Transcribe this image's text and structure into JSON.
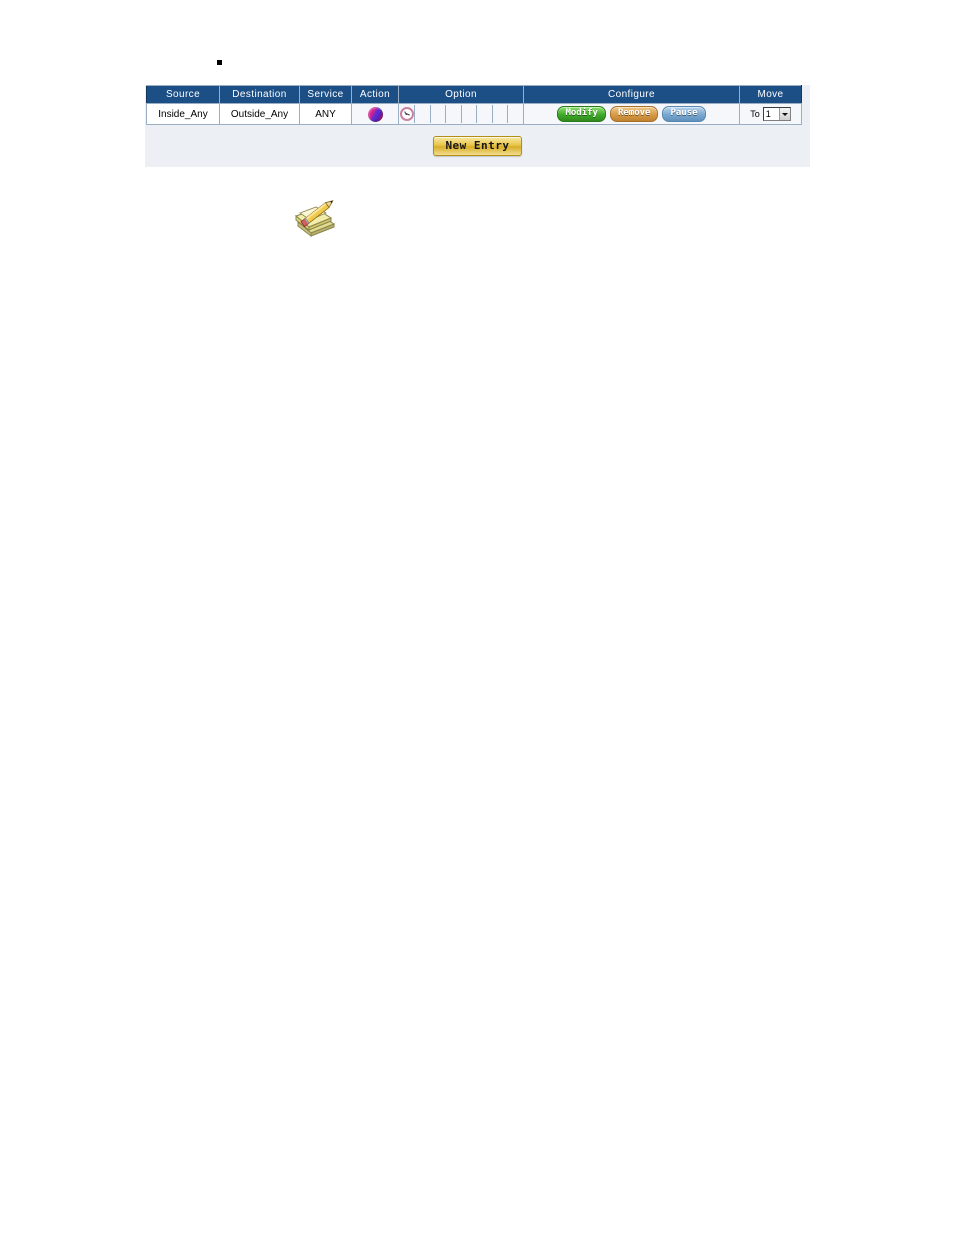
{
  "page": {
    "bullet_marker": "square-bullet"
  },
  "policy_table": {
    "headers": [
      {
        "key": "source",
        "label": "Source"
      },
      {
        "key": "destination",
        "label": "Destination"
      },
      {
        "key": "service",
        "label": "Service"
      },
      {
        "key": "action",
        "label": "Action"
      },
      {
        "key": "option",
        "label": "Option"
      },
      {
        "key": "configure",
        "label": "Configure"
      },
      {
        "key": "move",
        "label": "Move"
      }
    ],
    "rows": [
      {
        "source": "Inside_Any",
        "destination": "Outside_Any",
        "service": "ANY",
        "action_icon": "pass-sphere-icon",
        "option_cells": [
          {
            "icon": "schedule-clock-icon"
          },
          {
            "icon": ""
          },
          {
            "icon": ""
          },
          {
            "icon": ""
          },
          {
            "icon": ""
          },
          {
            "icon": ""
          },
          {
            "icon": ""
          },
          {
            "icon": ""
          }
        ],
        "configure": {
          "modify_label": "Modify",
          "remove_label": "Remove",
          "pause_label": "Pause"
        },
        "move": {
          "prefix_label": "To",
          "selected_value": "1",
          "options": [
            "1"
          ]
        }
      }
    ],
    "footer": {
      "new_entry_label": "New Entry"
    }
  },
  "note_icon": {
    "name": "note-pencil-icon"
  },
  "colors": {
    "header_blue": "#1c4f86",
    "panel_background": "#eceff4",
    "grid_border": "#9aaec4",
    "row_background": "#f5f7fa",
    "modify_green": "#3faa2a",
    "remove_orange": "#d79a48",
    "pause_blue": "#7aa8d0",
    "new_entry_gold": "#e8c64a",
    "action_icon_magenta": "#d11d8e"
  }
}
